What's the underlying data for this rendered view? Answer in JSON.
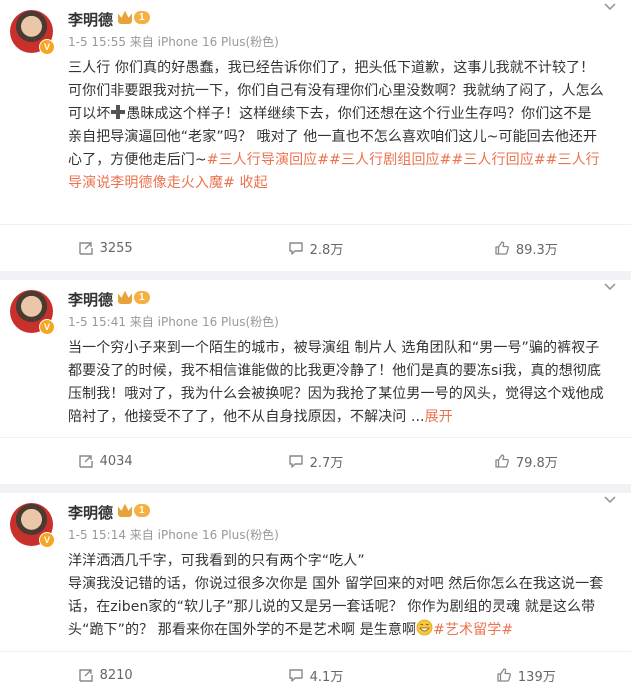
{
  "posts": [
    {
      "author": "李明德",
      "level": "1",
      "meta": "1-5 15:55 来自 iPhone 16 Plus(粉色)",
      "text_before": "三人行 你们真的好愚蠢，我已经告诉你们了，把头低下道歉，这事儿我就不计较了！可你们非要跟我对抗一下，你们自己有没有理你们心里没数啊？我就纳了闷了，人怎么可以坏",
      "text_after": "愚昧成这个样子！这样继续下去，你们还想在这个行业生存吗？你们这不是亲自把导演逼回他“老家”吗？ 哦对了 他一直也不怎么喜欢咱们这儿~可能回去他还开心了，方便他走后门~",
      "topics": [
        "#三人行导演回应#",
        "#三人行剧组回应#",
        "#三人行回应#",
        "#三人行导演说李明德像走火入魔#"
      ],
      "trailing": " 收起",
      "repost": "3255",
      "comment": "2.8万",
      "like": "89.3万"
    },
    {
      "author": "李明德",
      "level": "1",
      "meta": "1-5 15:41 来自 iPhone 16 Plus(粉色)",
      "text": "当一个穷小子来到一个陌生的城市，被导演组 制片人 选角团队和“男一号”骗的裤衩子都要没了的时候，我不相信谁能做的比我更冷静了！他们是真的要冻si我，真的想彻底压制我！哦对了，我为什么会被换呢？因为我抢了某位男一号的风头，觉得这个戏他成陪衬了，他接受不了了，他不从自身找原因，不解决问 ...",
      "expand": "展开",
      "repost": "4034",
      "comment": "2.7万",
      "like": "79.8万"
    },
    {
      "author": "李明德",
      "level": "1",
      "meta": "1-5 15:14 来自 iPhone 16 Plus(粉色)",
      "line1": "洋洋洒洒几千字，可我看到的只有两个字“吃人”",
      "text": "导演我没记错的话，你说过很多次你是 国外 留学回来的对吧 然后你怎么在我这说一套话，在ziben家的“软儿子”那儿说的又是另一套话呢？ 你作为剧组的灵魂 就是这么带头“跪下”的？ 那看来你在国外学的不是艺术啊 是生意啊",
      "topics": [
        "#艺术留学#"
      ],
      "repost": "8210",
      "comment": "4.1万",
      "like": "139万"
    }
  ],
  "colors": {
    "topic": "#eb7350",
    "meta": "#999999",
    "background": "#f1f2f5"
  },
  "icons": [
    "more-icon",
    "repost-icon",
    "comment-icon",
    "like-icon",
    "cross-icon",
    "grin-emoji-icon",
    "verified-v-icon",
    "crown-icon"
  ]
}
